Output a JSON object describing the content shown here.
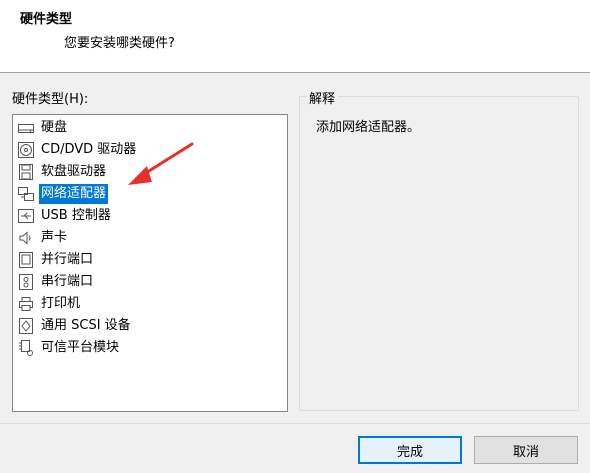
{
  "header": {
    "title": "硬件类型",
    "subtitle": "您要安装哪类硬件?"
  },
  "hardware_list": {
    "label": "硬件类型(H):",
    "selected_index": 3,
    "items": [
      {
        "label": "硬盘",
        "icon": "hard-disk-icon"
      },
      {
        "label": "CD/DVD 驱动器",
        "icon": "cd-dvd-icon"
      },
      {
        "label": "软盘驱动器",
        "icon": "floppy-icon"
      },
      {
        "label": "网络适配器",
        "icon": "network-adapter-icon"
      },
      {
        "label": "USB 控制器",
        "icon": "usb-icon"
      },
      {
        "label": "声卡",
        "icon": "speaker-icon"
      },
      {
        "label": "并行端口",
        "icon": "parallel-port-icon"
      },
      {
        "label": "串行端口",
        "icon": "serial-port-icon"
      },
      {
        "label": "打印机",
        "icon": "printer-icon"
      },
      {
        "label": "通用 SCSI 设备",
        "icon": "scsi-icon"
      },
      {
        "label": "可信平台模块",
        "icon": "tpm-icon"
      }
    ]
  },
  "explanation": {
    "legend": "解释",
    "text": "添加网络适配器。"
  },
  "buttons": {
    "finish": "完成",
    "cancel": "取消"
  },
  "colors": {
    "selection": "#0078d7",
    "annotation_arrow": "#e8302a"
  }
}
